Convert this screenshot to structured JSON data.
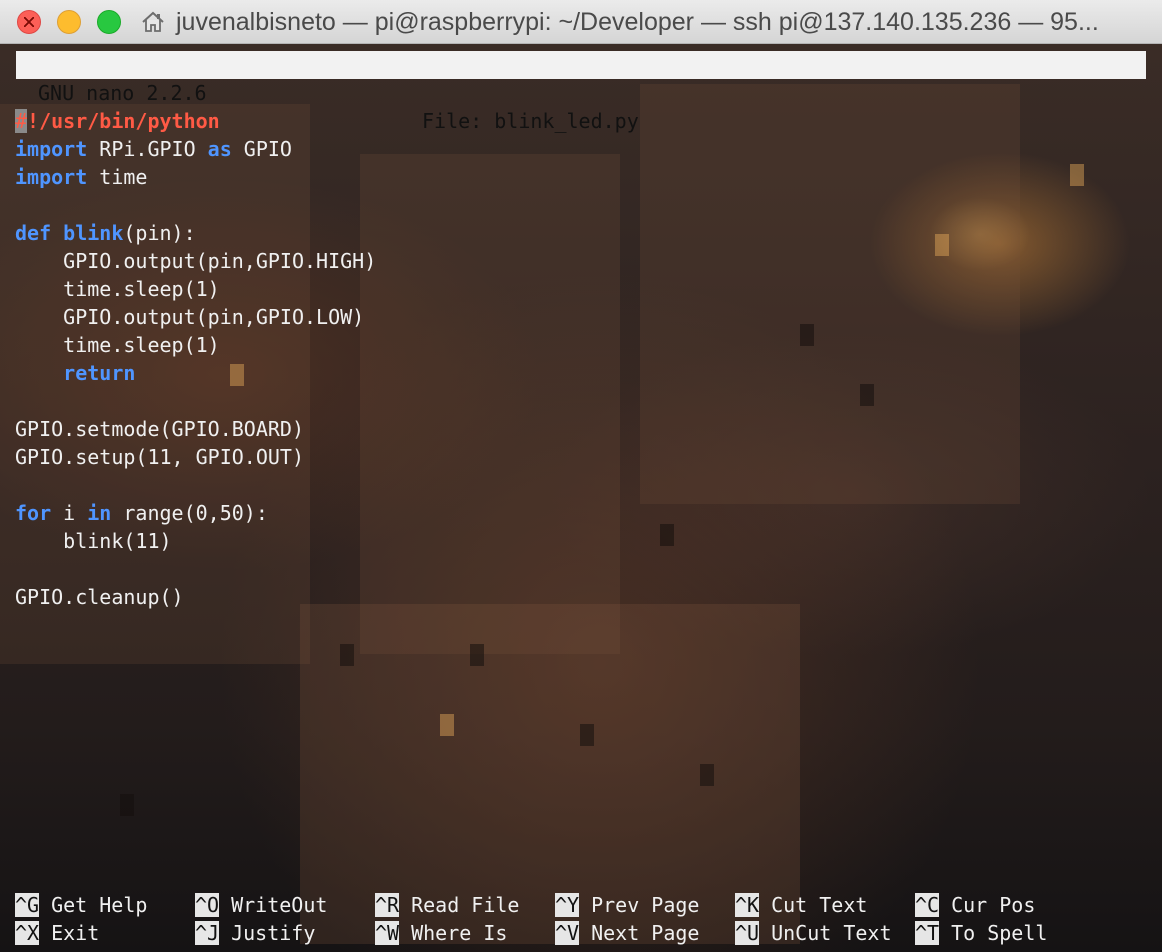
{
  "window": {
    "title": "juvenalbisneto — pi@raspberrypi: ~/Developer — ssh pi@137.140.135.236 — 95...",
    "title_icon": "home-icon"
  },
  "nano": {
    "version": "GNU nano 2.2.6",
    "file": "File: blink_led.py"
  },
  "code_lines": [
    [
      {
        "t": "#",
        "c": "cursor"
      },
      {
        "t": "!/usr/bin/python",
        "c": "shebang"
      }
    ],
    [
      {
        "t": "import",
        "c": "kw"
      },
      {
        "t": " RPi.GPIO "
      },
      {
        "t": "as",
        "c": "kw"
      },
      {
        "t": " GPIO"
      }
    ],
    [
      {
        "t": "import",
        "c": "kw"
      },
      {
        "t": " time"
      }
    ],
    [],
    [
      {
        "t": "def",
        "c": "kw"
      },
      {
        "t": " "
      },
      {
        "t": "blink",
        "c": "kw"
      },
      {
        "t": "(pin):"
      }
    ],
    [
      {
        "t": "    GPIO.output(pin,GPIO.HIGH)"
      }
    ],
    [
      {
        "t": "    time.sleep(1)"
      }
    ],
    [
      {
        "t": "    GPIO.output(pin,GPIO.LOW)"
      }
    ],
    [
      {
        "t": "    time.sleep(1)"
      }
    ],
    [
      {
        "t": "    "
      },
      {
        "t": "return",
        "c": "kw"
      }
    ],
    [],
    [
      {
        "t": "GPIO.setmode(GPIO.BOARD)"
      }
    ],
    [
      {
        "t": "GPIO.setup(11, GPIO.OUT)"
      }
    ],
    [],
    [
      {
        "t": "for",
        "c": "kw"
      },
      {
        "t": " i "
      },
      {
        "t": "in",
        "c": "kw"
      },
      {
        "t": " range(0,50):"
      }
    ],
    [
      {
        "t": "    blink(11)"
      }
    ],
    [],
    [
      {
        "t": "GPIO.cleanup()"
      }
    ]
  ],
  "shortcuts": [
    {
      "key": "^G",
      "label": "Get Help"
    },
    {
      "key": "^O",
      "label": "WriteOut"
    },
    {
      "key": "^R",
      "label": "Read File"
    },
    {
      "key": "^Y",
      "label": "Prev Page"
    },
    {
      "key": "^K",
      "label": "Cut Text"
    },
    {
      "key": "^C",
      "label": "Cur Pos"
    },
    {
      "key": "^X",
      "label": "Exit"
    },
    {
      "key": "^J",
      "label": "Justify"
    },
    {
      "key": "^W",
      "label": "Where Is"
    },
    {
      "key": "^V",
      "label": "Next Page"
    },
    {
      "key": "^U",
      "label": "UnCut Text"
    },
    {
      "key": "^T",
      "label": "To Spell"
    }
  ]
}
